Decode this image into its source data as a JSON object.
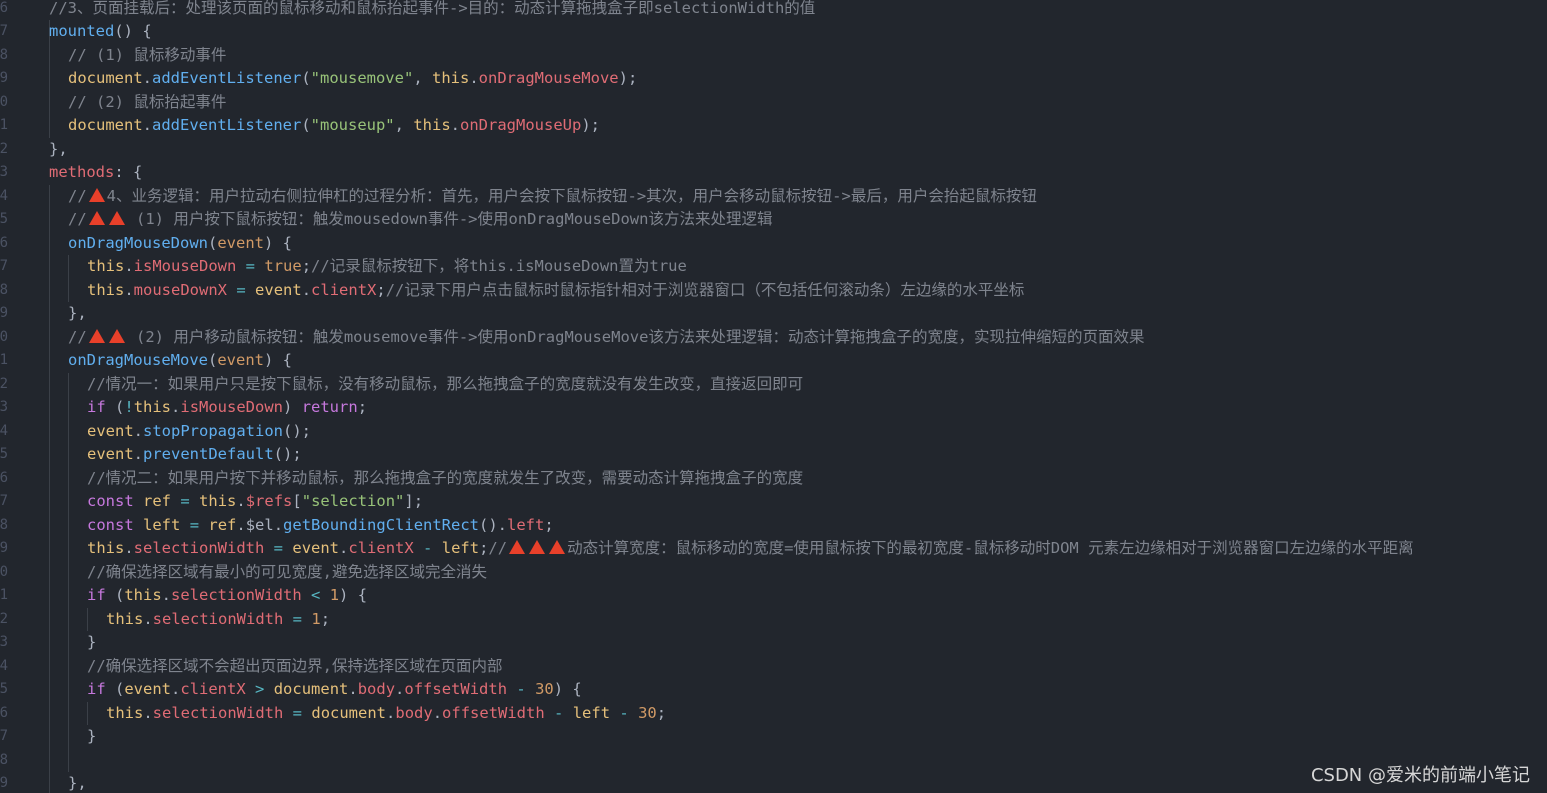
{
  "gutter": {
    "line_numbers": [
      "6",
      "7",
      "8",
      "9",
      "0",
      "1",
      "2",
      "3",
      "4",
      "5",
      "6",
      "7",
      "8",
      "9",
      "0",
      "1",
      "2",
      "3",
      "4",
      "5",
      "6",
      "7",
      "8",
      "9",
      "0",
      "1",
      "2",
      "3",
      "4",
      "5",
      "6",
      "7",
      "8",
      "9"
    ]
  },
  "code": {
    "l01": [
      {
        "c": "c",
        "t": "//3、页面挂载后：处理该页面的鼠标移动和鼠标抬起事件->目的：动态计算拖拽盒子即selectionWidth的值"
      }
    ],
    "l02": [
      {
        "c": "f",
        "t": "mounted"
      },
      {
        "c": "d",
        "t": "() {"
      }
    ],
    "l03": [
      {
        "c": "c",
        "t": "// (1) 鼠标移动事件"
      }
    ],
    "l04": [
      {
        "c": "t",
        "t": "document"
      },
      {
        "c": "d",
        "t": "."
      },
      {
        "c": "f",
        "t": "addEventListener"
      },
      {
        "c": "d",
        "t": "("
      },
      {
        "c": "s",
        "t": "\"mousemove\""
      },
      {
        "c": "d",
        "t": ", "
      },
      {
        "c": "t",
        "t": "this"
      },
      {
        "c": "d",
        "t": "."
      },
      {
        "c": "p",
        "t": "onDragMouseMove"
      },
      {
        "c": "d",
        "t": ");"
      }
    ],
    "l05": [
      {
        "c": "c",
        "t": "// (2) 鼠标抬起事件"
      }
    ],
    "l06": [
      {
        "c": "t",
        "t": "document"
      },
      {
        "c": "d",
        "t": "."
      },
      {
        "c": "f",
        "t": "addEventListener"
      },
      {
        "c": "d",
        "t": "("
      },
      {
        "c": "s",
        "t": "\"mouseup\""
      },
      {
        "c": "d",
        "t": ", "
      },
      {
        "c": "t",
        "t": "this"
      },
      {
        "c": "d",
        "t": "."
      },
      {
        "c": "p",
        "t": "onDragMouseUp"
      },
      {
        "c": "d",
        "t": ");"
      }
    ],
    "l07": [
      {
        "c": "d",
        "t": "},"
      }
    ],
    "l08": [
      {
        "c": "p",
        "t": "methods"
      },
      {
        "c": "d",
        "t": ": {"
      }
    ],
    "l09": [
      {
        "c": "c",
        "t": "//"
      },
      {
        "c": "tri",
        "t": ""
      },
      {
        "c": "c",
        "t": "4、业务逻辑：用户拉动右侧拉伸杠的过程分析：首先，用户会按下鼠标按钮->其次，用户会移动鼠标按钮->最后，用户会抬起鼠标按钮"
      }
    ],
    "l10": [
      {
        "c": "c",
        "t": "//"
      },
      {
        "c": "tri",
        "t": ""
      },
      {
        "c": "tri",
        "t": ""
      },
      {
        "c": "c",
        "t": " (1) 用户按下鼠标按钮：触发mousedown事件->使用onDragMouseDown该方法来处理逻辑"
      }
    ],
    "l11": [
      {
        "c": "f",
        "t": "onDragMouseDown"
      },
      {
        "c": "d",
        "t": "("
      },
      {
        "c": "n",
        "t": "event"
      },
      {
        "c": "d",
        "t": ") {"
      }
    ],
    "l12": [
      {
        "c": "t",
        "t": "this"
      },
      {
        "c": "d",
        "t": "."
      },
      {
        "c": "p",
        "t": "isMouseDown"
      },
      {
        "c": "d",
        "t": " "
      },
      {
        "c": "o",
        "t": "="
      },
      {
        "c": "d",
        "t": " "
      },
      {
        "c": "n",
        "t": "true"
      },
      {
        "c": "d",
        "t": ";"
      },
      {
        "c": "c",
        "t": "//记录鼠标按钮下，将this.isMouseDown置为true"
      }
    ],
    "l13": [
      {
        "c": "t",
        "t": "this"
      },
      {
        "c": "d",
        "t": "."
      },
      {
        "c": "p",
        "t": "mouseDownX"
      },
      {
        "c": "d",
        "t": " "
      },
      {
        "c": "o",
        "t": "="
      },
      {
        "c": "d",
        "t": " "
      },
      {
        "c": "v",
        "t": "event"
      },
      {
        "c": "d",
        "t": "."
      },
      {
        "c": "p",
        "t": "clientX"
      },
      {
        "c": "d",
        "t": ";"
      },
      {
        "c": "c",
        "t": "//记录下用户点击鼠标时鼠标指针相对于浏览器窗口（不包括任何滚动条）左边缘的水平坐标"
      }
    ],
    "l14": [
      {
        "c": "d",
        "t": "},"
      }
    ],
    "l15": [
      {
        "c": "c",
        "t": "//"
      },
      {
        "c": "tri",
        "t": ""
      },
      {
        "c": "tri",
        "t": ""
      },
      {
        "c": "c",
        "t": " (2) 用户移动鼠标按钮：触发mousemove事件->使用onDragMouseMove该方法来处理逻辑：动态计算拖拽盒子的宽度，实现拉伸缩短的页面效果"
      }
    ],
    "l16": [
      {
        "c": "f",
        "t": "onDragMouseMove"
      },
      {
        "c": "d",
        "t": "("
      },
      {
        "c": "n",
        "t": "event"
      },
      {
        "c": "d",
        "t": ") {"
      }
    ],
    "l17": [
      {
        "c": "c",
        "t": "//情况一：如果用户只是按下鼠标，没有移动鼠标，那么拖拽盒子的宽度就没有发生改变，直接返回即可"
      }
    ],
    "l18": [
      {
        "c": "k",
        "t": "if"
      },
      {
        "c": "d",
        "t": " ("
      },
      {
        "c": "o",
        "t": "!"
      },
      {
        "c": "t",
        "t": "this"
      },
      {
        "c": "d",
        "t": "."
      },
      {
        "c": "p",
        "t": "isMouseDown"
      },
      {
        "c": "d",
        "t": ") "
      },
      {
        "c": "k",
        "t": "return"
      },
      {
        "c": "d",
        "t": ";"
      }
    ],
    "l19": [
      {
        "c": "v",
        "t": "event"
      },
      {
        "c": "d",
        "t": "."
      },
      {
        "c": "f",
        "t": "stopPropagation"
      },
      {
        "c": "d",
        "t": "();"
      }
    ],
    "l20": [
      {
        "c": "v",
        "t": "event"
      },
      {
        "c": "d",
        "t": "."
      },
      {
        "c": "f",
        "t": "preventDefault"
      },
      {
        "c": "d",
        "t": "();"
      }
    ],
    "l21": [
      {
        "c": "c",
        "t": "//情况二：如果用户按下并移动鼠标，那么拖拽盒子的宽度就发生了改变，需要动态计算拖拽盒子的宽度"
      }
    ],
    "l22": [
      {
        "c": "k",
        "t": "const"
      },
      {
        "c": "d",
        "t": " "
      },
      {
        "c": "v",
        "t": "ref"
      },
      {
        "c": "d",
        "t": " "
      },
      {
        "c": "o",
        "t": "="
      },
      {
        "c": "d",
        "t": " "
      },
      {
        "c": "t",
        "t": "this"
      },
      {
        "c": "d",
        "t": "."
      },
      {
        "c": "p",
        "t": "$refs"
      },
      {
        "c": "d",
        "t": "["
      },
      {
        "c": "s",
        "t": "\"selection\""
      },
      {
        "c": "d",
        "t": "];"
      }
    ],
    "l23": [
      {
        "c": "k",
        "t": "const"
      },
      {
        "c": "d",
        "t": " "
      },
      {
        "c": "v",
        "t": "left"
      },
      {
        "c": "d",
        "t": " "
      },
      {
        "c": "o",
        "t": "="
      },
      {
        "c": "d",
        "t": " "
      },
      {
        "c": "v",
        "t": "ref"
      },
      {
        "c": "d",
        "t": ".$el."
      },
      {
        "c": "f",
        "t": "getBoundingClientRect"
      },
      {
        "c": "d",
        "t": "()."
      },
      {
        "c": "p",
        "t": "left"
      },
      {
        "c": "d",
        "t": ";"
      }
    ],
    "l24": [
      {
        "c": "t",
        "t": "this"
      },
      {
        "c": "d",
        "t": "."
      },
      {
        "c": "p",
        "t": "selectionWidth"
      },
      {
        "c": "d",
        "t": " "
      },
      {
        "c": "o",
        "t": "="
      },
      {
        "c": "d",
        "t": " "
      },
      {
        "c": "v",
        "t": "event"
      },
      {
        "c": "d",
        "t": "."
      },
      {
        "c": "p",
        "t": "clientX"
      },
      {
        "c": "d",
        "t": " "
      },
      {
        "c": "o",
        "t": "-"
      },
      {
        "c": "d",
        "t": " "
      },
      {
        "c": "v",
        "t": "left"
      },
      {
        "c": "d",
        "t": ";"
      },
      {
        "c": "c",
        "t": "//"
      },
      {
        "c": "tri",
        "t": ""
      },
      {
        "c": "tri",
        "t": ""
      },
      {
        "c": "tri",
        "t": ""
      },
      {
        "c": "c",
        "t": "动态计算宽度：鼠标移动的宽度=使用鼠标按下的最初宽度-鼠标移动时DOM 元素左边缘相对于浏览器窗口左边缘的水平距离"
      }
    ],
    "l25": [
      {
        "c": "c",
        "t": "//确保选择区域有最小的可见宽度,避免选择区域完全消失"
      }
    ],
    "l26": [
      {
        "c": "k",
        "t": "if"
      },
      {
        "c": "d",
        "t": " ("
      },
      {
        "c": "t",
        "t": "this"
      },
      {
        "c": "d",
        "t": "."
      },
      {
        "c": "p",
        "t": "selectionWidth"
      },
      {
        "c": "d",
        "t": " "
      },
      {
        "c": "o",
        "t": "<"
      },
      {
        "c": "d",
        "t": " "
      },
      {
        "c": "n",
        "t": "1"
      },
      {
        "c": "d",
        "t": ") {"
      }
    ],
    "l27": [
      {
        "c": "t",
        "t": "this"
      },
      {
        "c": "d",
        "t": "."
      },
      {
        "c": "p",
        "t": "selectionWidth"
      },
      {
        "c": "d",
        "t": " "
      },
      {
        "c": "o",
        "t": "="
      },
      {
        "c": "d",
        "t": " "
      },
      {
        "c": "n",
        "t": "1"
      },
      {
        "c": "d",
        "t": ";"
      }
    ],
    "l28": [
      {
        "c": "d",
        "t": "}"
      }
    ],
    "l29": [
      {
        "c": "c",
        "t": "//确保选择区域不会超出页面边界,保持选择区域在页面内部"
      }
    ],
    "l30": [
      {
        "c": "k",
        "t": "if"
      },
      {
        "c": "d",
        "t": " ("
      },
      {
        "c": "v",
        "t": "event"
      },
      {
        "c": "d",
        "t": "."
      },
      {
        "c": "p",
        "t": "clientX"
      },
      {
        "c": "d",
        "t": " "
      },
      {
        "c": "o",
        "t": ">"
      },
      {
        "c": "d",
        "t": " "
      },
      {
        "c": "t",
        "t": "document"
      },
      {
        "c": "d",
        "t": "."
      },
      {
        "c": "p",
        "t": "body"
      },
      {
        "c": "d",
        "t": "."
      },
      {
        "c": "p",
        "t": "offsetWidth"
      },
      {
        "c": "d",
        "t": " "
      },
      {
        "c": "o",
        "t": "-"
      },
      {
        "c": "d",
        "t": " "
      },
      {
        "c": "n",
        "t": "30"
      },
      {
        "c": "d",
        "t": ") {"
      }
    ],
    "l31": [
      {
        "c": "t",
        "t": "this"
      },
      {
        "c": "d",
        "t": "."
      },
      {
        "c": "p",
        "t": "selectionWidth"
      },
      {
        "c": "d",
        "t": " "
      },
      {
        "c": "o",
        "t": "="
      },
      {
        "c": "d",
        "t": " "
      },
      {
        "c": "t",
        "t": "document"
      },
      {
        "c": "d",
        "t": "."
      },
      {
        "c": "p",
        "t": "body"
      },
      {
        "c": "d",
        "t": "."
      },
      {
        "c": "p",
        "t": "offsetWidth"
      },
      {
        "c": "d",
        "t": " "
      },
      {
        "c": "o",
        "t": "-"
      },
      {
        "c": "d",
        "t": " "
      },
      {
        "c": "v",
        "t": "left"
      },
      {
        "c": "d",
        "t": " "
      },
      {
        "c": "o",
        "t": "-"
      },
      {
        "c": "d",
        "t": " "
      },
      {
        "c": "n",
        "t": "30"
      },
      {
        "c": "d",
        "t": ";"
      }
    ],
    "l32": [
      {
        "c": "d",
        "t": "}"
      }
    ],
    "l33": [],
    "l34": [
      {
        "c": "d",
        "t": "},"
      }
    ]
  },
  "watermark": "CSDN @爱米的前端小笔记",
  "colors": {
    "background": "#22262d",
    "comment": "#7f848e",
    "keyword": "#c678dd",
    "function": "#61afef",
    "property": "#e06c75",
    "string": "#98c379",
    "number": "#d19a66",
    "operator": "#56b6c2",
    "this": "#e5c07b",
    "warning_icon": "#e8402a"
  }
}
